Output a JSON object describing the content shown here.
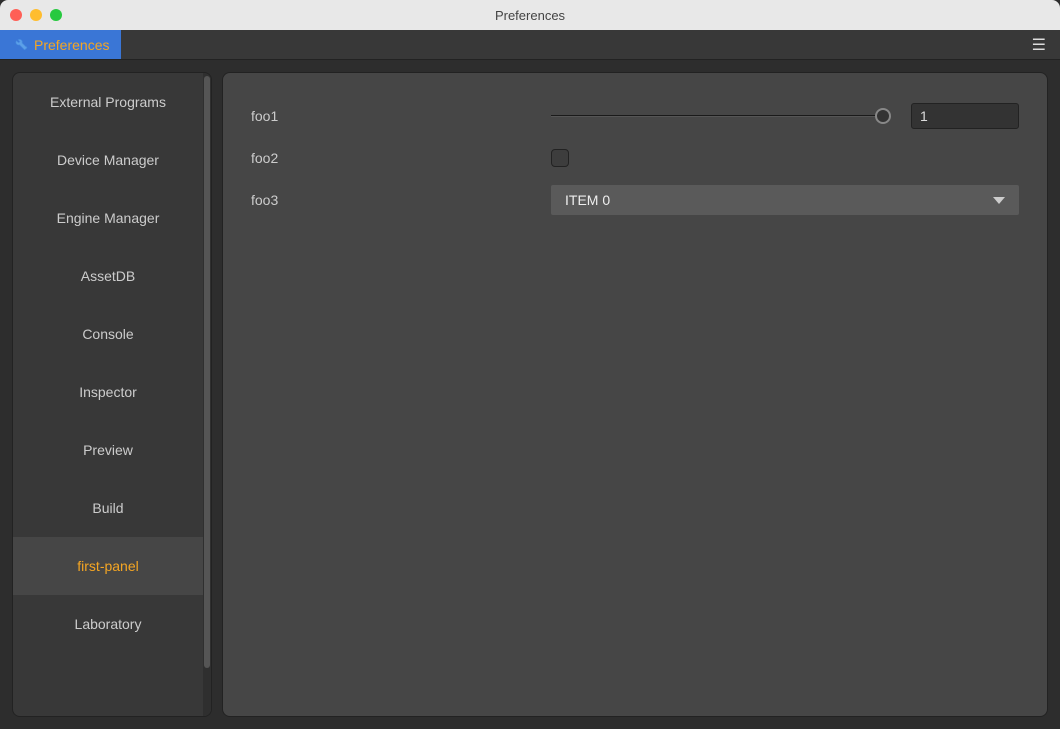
{
  "window": {
    "title": "Preferences"
  },
  "tab": {
    "label": "Preferences"
  },
  "sidebar": {
    "items": [
      {
        "label": "External Programs",
        "active": false
      },
      {
        "label": "Device Manager",
        "active": false
      },
      {
        "label": "Engine Manager",
        "active": false
      },
      {
        "label": "AssetDB",
        "active": false
      },
      {
        "label": "Console",
        "active": false
      },
      {
        "label": "Inspector",
        "active": false
      },
      {
        "label": "Preview",
        "active": false
      },
      {
        "label": "Build",
        "active": false
      },
      {
        "label": "first-panel",
        "active": true
      },
      {
        "label": "Laboratory",
        "active": false
      }
    ]
  },
  "fields": {
    "foo1": {
      "label": "foo1",
      "value": "1",
      "slider": 1.0
    },
    "foo2": {
      "label": "foo2",
      "checked": false
    },
    "foo3": {
      "label": "foo3",
      "selected": "ITEM 0"
    }
  },
  "colors": {
    "accent": "#f5a623",
    "tabBg": "#3a76d6",
    "panelBg": "#464646",
    "sidebarBg": "#383838",
    "appBg": "#2d2d2d"
  }
}
